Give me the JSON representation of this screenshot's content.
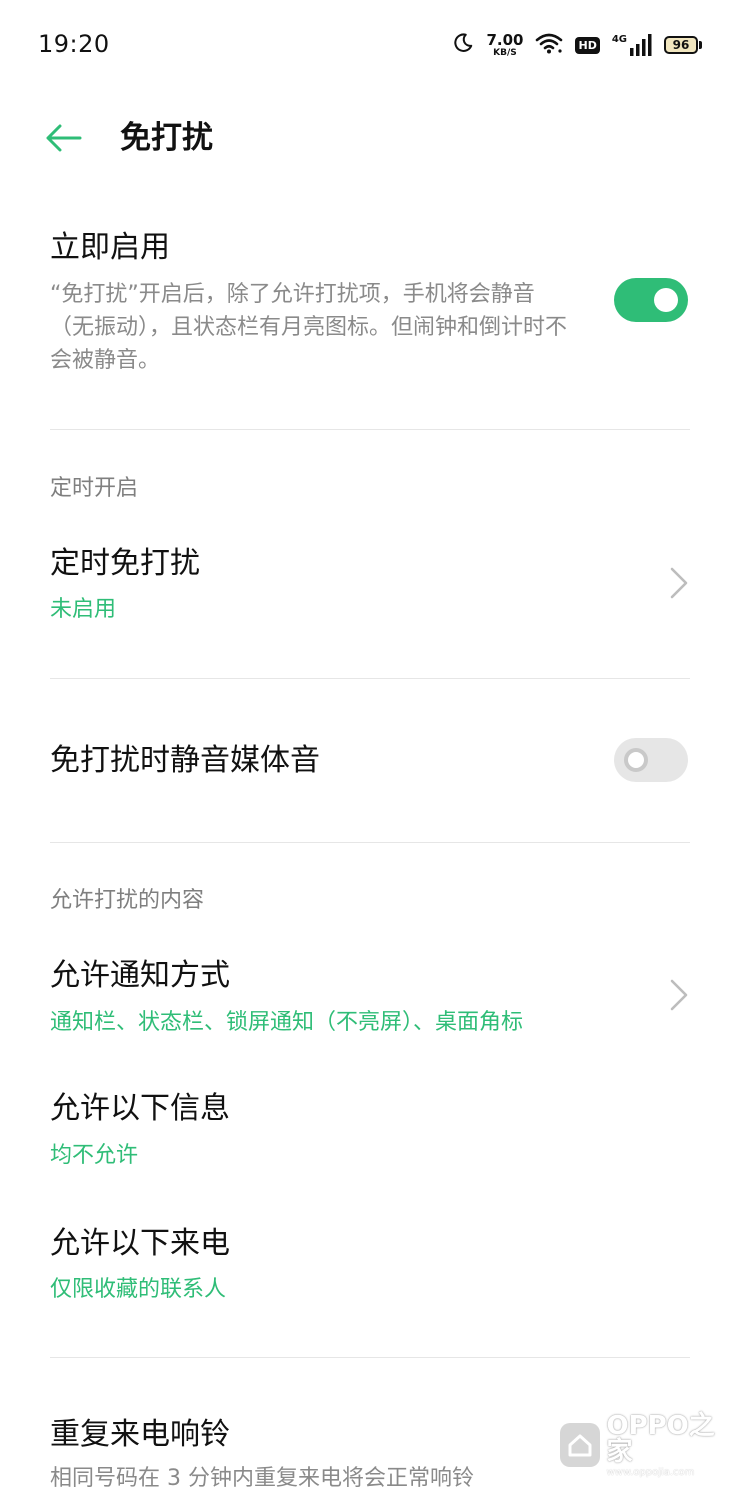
{
  "status_bar": {
    "time": "19:20",
    "net_speed_value": "7.00",
    "net_speed_unit": "KB/S",
    "hd_label": "HD",
    "network_type": "4G",
    "battery_level": "96"
  },
  "header": {
    "title": "免打扰"
  },
  "immediate": {
    "title": "立即启用",
    "description": "“免打扰”开启后，除了允许打扰项，手机将会静音（无振动），且状态栏有月亮图标。但闹钟和倒计时不会被静音。",
    "toggle_on": true
  },
  "schedule_section": {
    "header": "定时开启",
    "item_title": "定时免打扰",
    "item_status": "未启用"
  },
  "mute_media": {
    "title": "免打扰时静音媒体音",
    "toggle_on": false
  },
  "allowed_section": {
    "header": "允许打扰的内容",
    "notification_title": "允许通知方式",
    "notification_value": "通知栏、状态栏、锁屏通知（不亮屏）、桌面角标",
    "messages_title": "允许以下信息",
    "messages_value": "均不允许",
    "calls_title": "允许以下来电",
    "calls_value": "仅限收藏的联系人"
  },
  "repeat_calls": {
    "title": "重复来电响铃",
    "description": "相同号码在 3 分钟内重复来电将会正常响铃"
  },
  "watermark": {
    "brand": "OPPO之家",
    "url": "www.oppojia.com"
  },
  "colors": {
    "accent": "#2fbd77",
    "text_primary": "#111111",
    "text_secondary": "#8a8a8a",
    "divider": "#e6e6e6",
    "toggle_off": "#e6e6e6"
  }
}
